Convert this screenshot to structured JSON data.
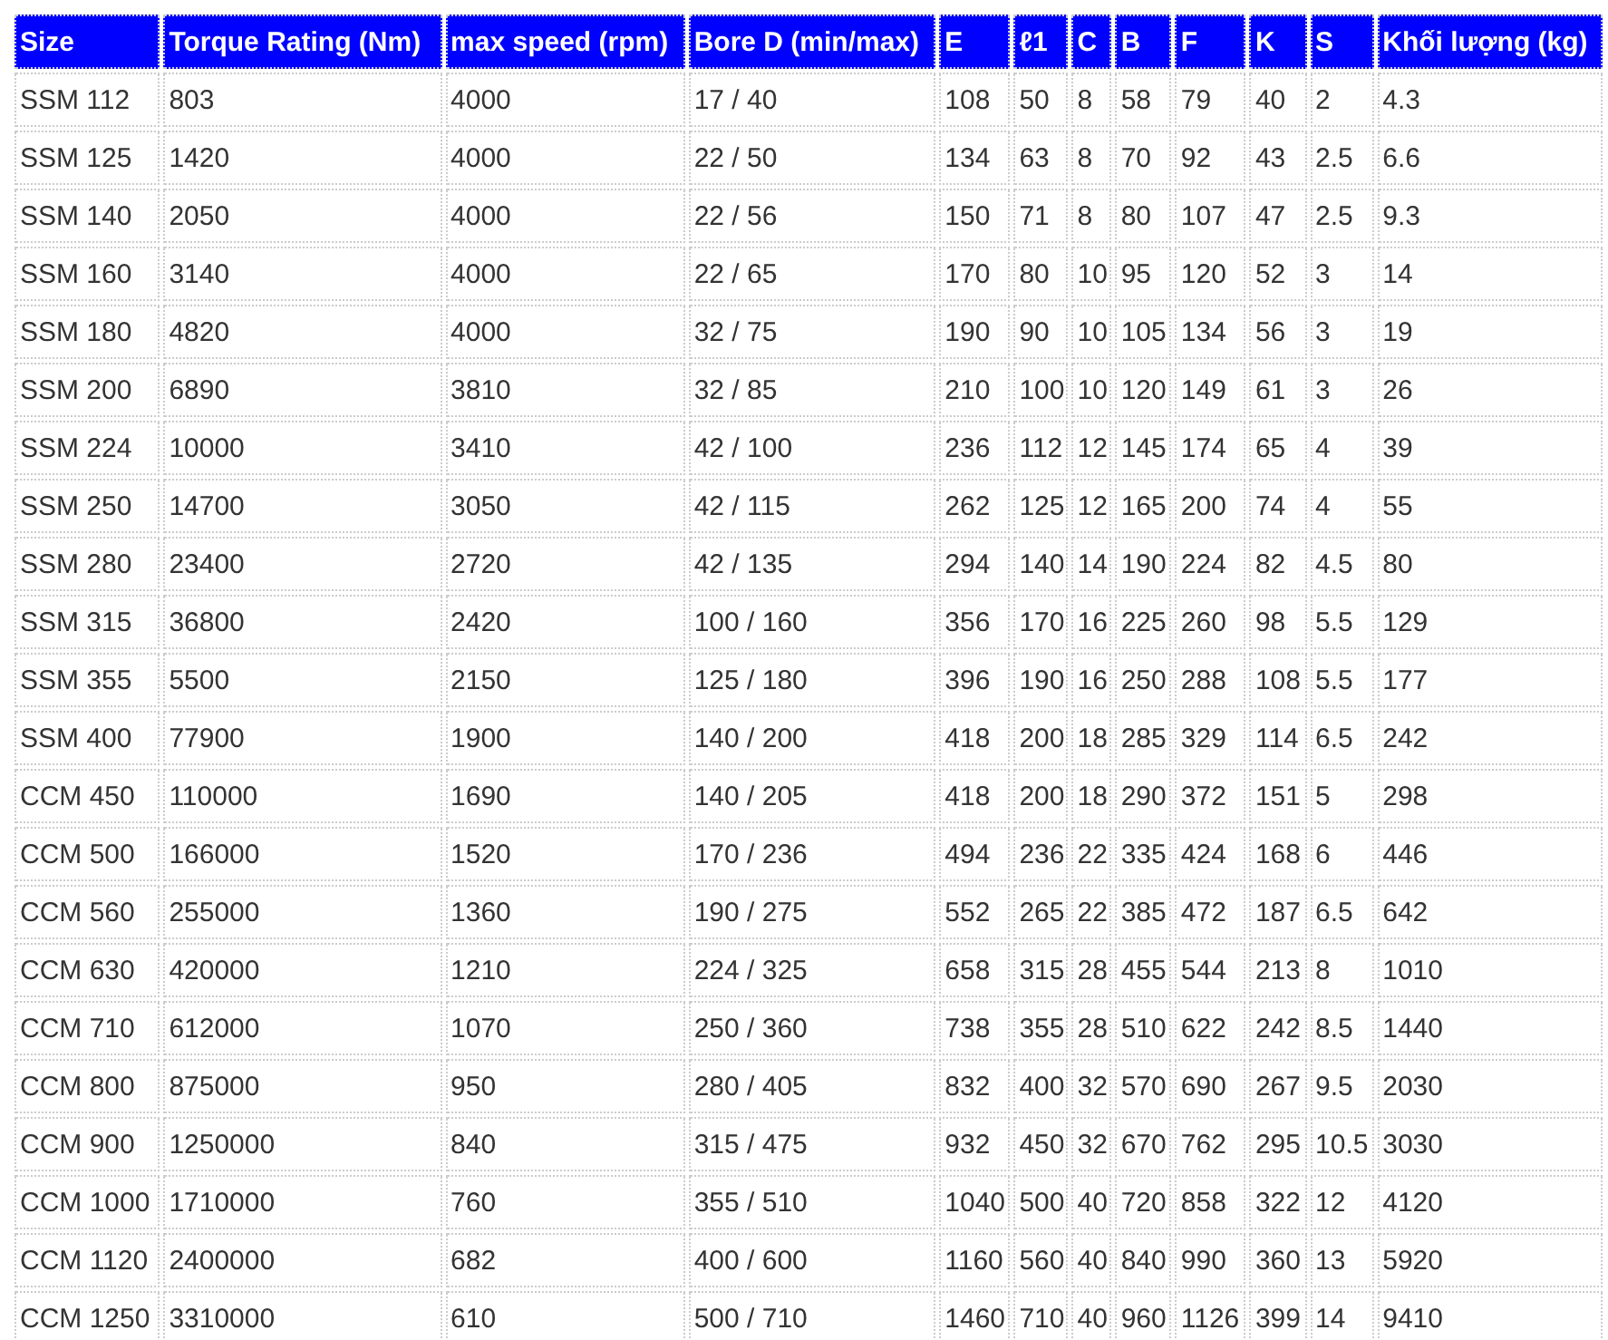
{
  "table": {
    "columns": [
      "Size",
      "Torque Rating (Nm)",
      "max speed (rpm)",
      "Bore D (min/max)",
      "E",
      "ℓ1",
      "C",
      "B",
      "F",
      "K",
      "S",
      "Khối lượng (kg)"
    ],
    "rows": [
      [
        "SSM 112",
        "803",
        "4000",
        "17 / 40",
        "108",
        "50",
        "8",
        "58",
        "79",
        "40",
        "2",
        "4.3"
      ],
      [
        "SSM 125",
        "1420",
        "4000",
        "22 / 50",
        "134",
        "63",
        "8",
        "70",
        "92",
        "43",
        "2.5",
        "6.6"
      ],
      [
        "SSM 140",
        "2050",
        "4000",
        "22 / 56",
        "150",
        "71",
        "8",
        "80",
        "107",
        "47",
        "2.5",
        "9.3"
      ],
      [
        "SSM 160",
        "3140",
        "4000",
        "22 / 65",
        "170",
        "80",
        "10",
        "95",
        "120",
        "52",
        "3",
        "14"
      ],
      [
        "SSM 180",
        "4820",
        "4000",
        "32 / 75",
        "190",
        "90",
        "10",
        "105",
        "134",
        "56",
        "3",
        "19"
      ],
      [
        "SSM 200",
        "6890",
        "3810",
        "32 / 85",
        "210",
        "100",
        "10",
        "120",
        "149",
        "61",
        "3",
        "26"
      ],
      [
        "SSM 224",
        "10000",
        "3410",
        "42 / 100",
        "236",
        "112",
        "12",
        "145",
        "174",
        "65",
        "4",
        "39"
      ],
      [
        "SSM 250",
        "14700",
        "3050",
        "42 / 115",
        "262",
        "125",
        "12",
        "165",
        "200",
        "74",
        "4",
        "55"
      ],
      [
        "SSM 280",
        "23400",
        "2720",
        "42 / 135",
        "294",
        "140",
        "14",
        "190",
        "224",
        "82",
        "4.5",
        "80"
      ],
      [
        "SSM 315",
        "36800",
        "2420",
        "100 / 160",
        "356",
        "170",
        "16",
        "225",
        "260",
        "98",
        "5.5",
        "129"
      ],
      [
        "SSM 355",
        "5500",
        "2150",
        "125 / 180",
        "396",
        "190",
        "16",
        "250",
        "288",
        "108",
        "5.5",
        "177"
      ],
      [
        "SSM 400",
        "77900",
        "1900",
        "140 / 200",
        "418",
        "200",
        "18",
        "285",
        "329",
        "114",
        "6.5",
        "242"
      ],
      [
        "CCM 450",
        "110000",
        "1690",
        "140 / 205",
        "418",
        "200",
        "18",
        "290",
        "372",
        "151",
        "5",
        "298"
      ],
      [
        "CCM 500",
        "166000",
        "1520",
        "170 / 236",
        "494",
        "236",
        "22",
        "335",
        "424",
        "168",
        "6",
        "446"
      ],
      [
        "CCM 560",
        "255000",
        "1360",
        "190 / 275",
        "552",
        "265",
        "22",
        "385",
        "472",
        "187",
        "6.5",
        "642"
      ],
      [
        "CCM 630",
        "420000",
        "1210",
        "224 / 325",
        "658",
        "315",
        "28",
        "455",
        "544",
        "213",
        "8",
        "1010"
      ],
      [
        "CCM 710",
        "612000",
        "1070",
        "250 / 360",
        "738",
        "355",
        "28",
        "510",
        "622",
        "242",
        "8.5",
        "1440"
      ],
      [
        "CCM 800",
        "875000",
        "950",
        "280 / 405",
        "832",
        "400",
        "32",
        "570",
        "690",
        "267",
        "9.5",
        "2030"
      ],
      [
        "CCM 900",
        "1250000",
        "840",
        "315 / 475",
        "932",
        "450",
        "32",
        "670",
        "762",
        "295",
        "10.5",
        "3030"
      ],
      [
        "CCM 1000",
        "1710000",
        "760",
        "355 / 510",
        "1040",
        "500",
        "40",
        "720",
        "858",
        "322",
        "12",
        "4120"
      ],
      [
        "CCM 1120",
        "2400000",
        "682",
        "400 / 600",
        "1160",
        "560",
        "40",
        "840",
        "990",
        "360",
        "13",
        "5920"
      ],
      [
        "CCM 1250",
        "3310000",
        "610",
        "500 / 710",
        "1460",
        "710",
        "40",
        "960",
        "1126",
        "399",
        "14",
        "9410"
      ]
    ]
  }
}
